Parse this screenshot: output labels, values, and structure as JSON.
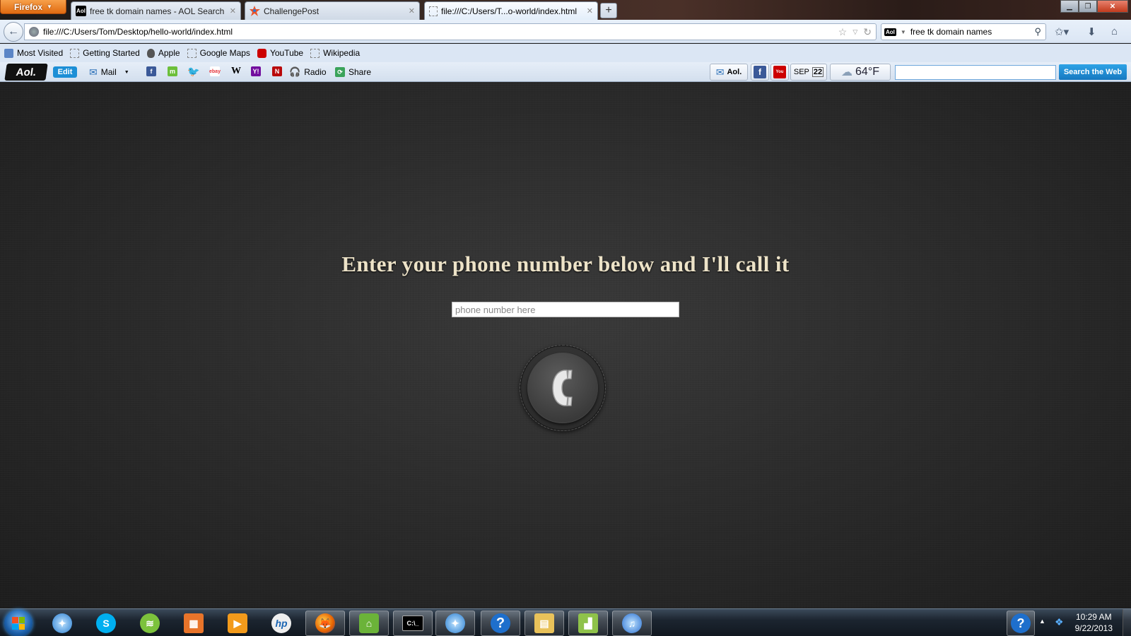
{
  "browser": {
    "menu_button": "Firefox",
    "tabs": [
      {
        "label": "free tk domain names - AOL Search R...",
        "icon": "aol-favicon"
      },
      {
        "label": "ChallengePost",
        "icon": "challengepost-favicon"
      },
      {
        "label": "file:///C:/Users/T...o-world/index.html",
        "icon": "blank-page-favicon",
        "active": true
      }
    ],
    "new_tab": "+",
    "url": "file:///C:/Users/Tom/Desktop/hello-world/index.html",
    "search_query": "free tk domain names"
  },
  "bookmarks": [
    "Most Visited",
    "Getting Started",
    "Apple",
    "Google Maps",
    "YouTube",
    "Wikipedia"
  ],
  "aol_toolbar": {
    "logo": "Aol.",
    "edit": "Edit",
    "mail": "Mail",
    "radio": "Radio",
    "share": "Share",
    "mail_chip": "Aol.",
    "month": "SEP",
    "day": "22",
    "temperature": "64°F",
    "search_button": "Search the Web"
  },
  "page": {
    "headline": "Enter your phone number below and I'll call it",
    "phone_placeholder": "phone number here",
    "phone_value": ""
  },
  "taskbar": {
    "time": "10:29 AM",
    "date": "9/22/2013"
  },
  "colors": {
    "headline": "#ede3c8",
    "background": "#2c2c2c",
    "aol_search_button": "#1d8fd6"
  }
}
